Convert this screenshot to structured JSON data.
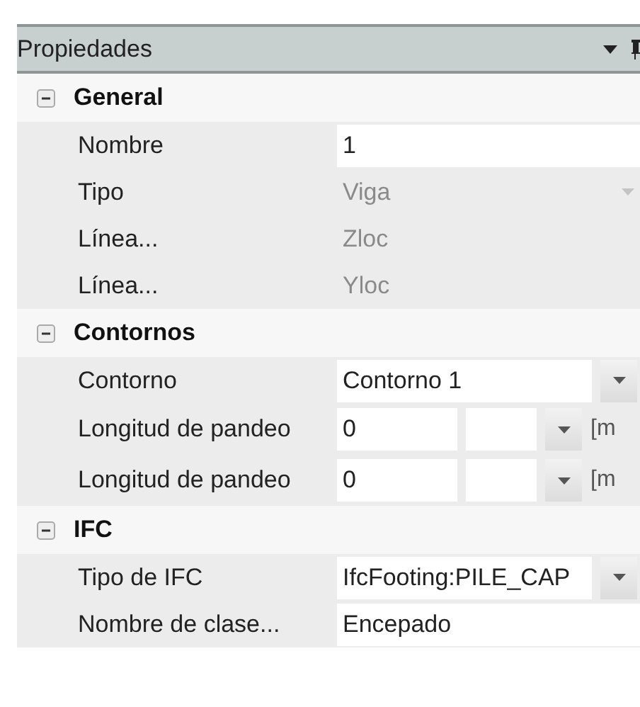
{
  "panel": {
    "title": "Propiedades"
  },
  "sections": [
    {
      "title": "General",
      "expanded": true,
      "properties": [
        {
          "label": "Nombre",
          "kind": "text",
          "value": "1",
          "disabled": false
        },
        {
          "label": "Tipo",
          "kind": "combo",
          "value": "Viga",
          "disabled": true
        },
        {
          "label": "Línea...",
          "kind": "text",
          "value": "Zloc",
          "disabled": true
        },
        {
          "label": "Línea...",
          "kind": "text",
          "value": "Yloc",
          "disabled": true
        }
      ]
    },
    {
      "title": "Contornos",
      "expanded": true,
      "properties": [
        {
          "label": "Contorno",
          "kind": "combo",
          "value": "Contorno 1",
          "disabled": false
        },
        {
          "label": "Longitud de pandeo",
          "kind": "unitcombo",
          "value": "0",
          "unit": "[m",
          "disabled": false
        },
        {
          "label": "Longitud de pandeo",
          "kind": "unitcombo",
          "value": "0",
          "unit": "[m",
          "disabled": false
        }
      ]
    },
    {
      "title": "IFC",
      "expanded": true,
      "properties": [
        {
          "label": "Tipo de IFC",
          "kind": "combo",
          "value": "IfcFooting:PILE_CAP",
          "disabled": false
        },
        {
          "label": "Nombre de clase...",
          "kind": "text",
          "value": "Encepado",
          "disabled": false
        }
      ]
    }
  ]
}
